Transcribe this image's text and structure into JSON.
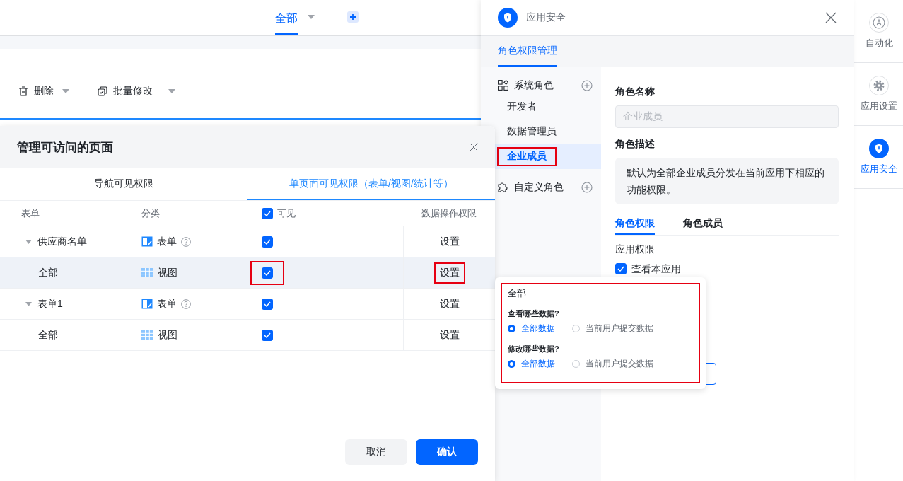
{
  "page_header": {
    "tabs": [
      {
        "label": "全部",
        "selected": true
      }
    ]
  },
  "toolbar": {
    "actions": [
      {
        "label": "删除"
      },
      {
        "label": "批量修改"
      }
    ]
  },
  "dialog": {
    "title": "管理可访问的页面",
    "tabs": [
      {
        "label": "导航可见权限",
        "selected": false
      },
      {
        "label": "单页面可见权限（表单/视图/统计等）",
        "selected": true
      }
    ],
    "columns": {
      "name": "表单",
      "category": "分类",
      "visible": {
        "label": "可见",
        "checked": true
      },
      "actions": "数据操作权限"
    },
    "rows": [
      {
        "name": "供应商名单",
        "expanded": true,
        "kind": "form",
        "category": "表单",
        "visible": true,
        "action": "设置",
        "hovered": false,
        "visible_annotated": false,
        "action_annotated": false,
        "children": [
          {
            "name": "全部",
            "kind": "view",
            "category": "视图",
            "visible": true,
            "action": "设置",
            "hovered": true,
            "visible_annotated": true,
            "action_annotated": true
          }
        ]
      },
      {
        "name": "表单1",
        "expanded": true,
        "kind": "form",
        "category": "表单",
        "visible": true,
        "action": "设置",
        "hovered": false,
        "visible_annotated": false,
        "action_annotated": false,
        "children": [
          {
            "name": "全部",
            "kind": "view",
            "category": "视图",
            "visible": true,
            "action": "设置",
            "hovered": false,
            "visible_annotated": false,
            "action_annotated": false
          }
        ]
      }
    ],
    "buttons": [
      {
        "label": "取消",
        "kind": "secondary"
      },
      {
        "label": "确认",
        "kind": "primary"
      }
    ]
  },
  "security_panel": {
    "title": "应用安全",
    "tabs": [
      {
        "label": "角色权限管理",
        "selected": true
      }
    ],
    "role_groups": [
      {
        "label": "系统角色",
        "roles": [
          {
            "label": "开发者",
            "selected": false,
            "annotated": false
          },
          {
            "label": "数据管理员",
            "selected": false,
            "annotated": false
          },
          {
            "label": "企业成员",
            "selected": true,
            "annotated": true
          }
        ]
      },
      {
        "label": "自定义角色"
      }
    ],
    "detail": {
      "name_label": "角色名称",
      "name_value": "企业成员",
      "name_disabled": true,
      "description_label": "角色描述",
      "description": "默认为全部企业成员分发在当前应用下相应的功能权限。",
      "tabs": [
        {
          "label": "角色权限",
          "selected": true
        },
        {
          "label": "角色成员",
          "selected": false
        }
      ],
      "section_label": "应用权限",
      "permissions": [
        {
          "label": "查看本应用",
          "checked": true
        }
      ]
    }
  },
  "popover": {
    "title": "全部",
    "annotated": true,
    "questions": [
      {
        "label": "查看哪些数据?",
        "options": [
          {
            "label": "全部数据",
            "selected": true
          },
          {
            "label": "当前用户提交数据",
            "selected": false
          }
        ]
      },
      {
        "label": "修改哪些数据?",
        "options": [
          {
            "label": "全部数据",
            "selected": true
          },
          {
            "label": "当前用户提交数据",
            "selected": false
          }
        ]
      }
    ]
  },
  "sidebar": {
    "items": [
      {
        "label": "自动化",
        "selected": false
      },
      {
        "label": "应用设置",
        "selected": false
      },
      {
        "label": "应用安全",
        "selected": true
      }
    ]
  }
}
